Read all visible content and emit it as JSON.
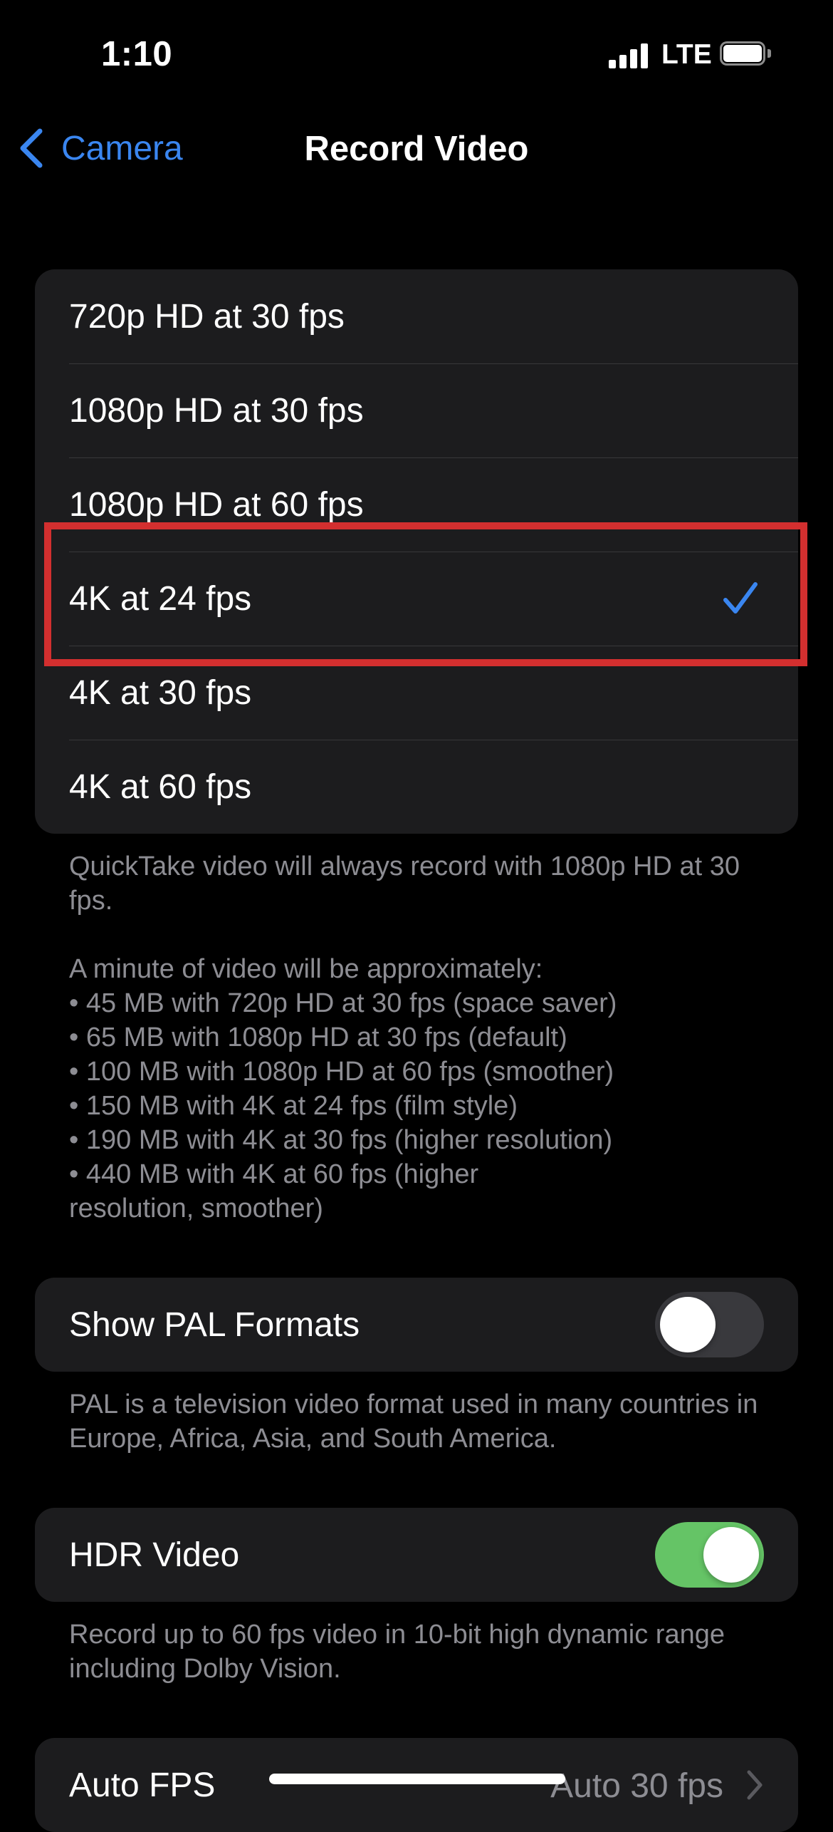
{
  "status_bar": {
    "time": "1:10",
    "network": "LTE",
    "signal_bars": 4,
    "battery_icon": "battery-full-icon"
  },
  "nav": {
    "back_label": "Camera",
    "title": "Record Video"
  },
  "formats": [
    {
      "label": "720p HD at 30 fps",
      "selected": false
    },
    {
      "label": "1080p HD at 30 fps",
      "selected": false
    },
    {
      "label": "1080p HD at 60 fps",
      "selected": false
    },
    {
      "label": "4K at 24 fps",
      "selected": true
    },
    {
      "label": "4K at 30 fps",
      "selected": false
    },
    {
      "label": "4K at 60 fps",
      "selected": false
    }
  ],
  "formats_footnote": {
    "quicktake": "QuickTake video will always record with 1080p HD at 30 fps.",
    "size_intro": "A minute of video will be approximately:",
    "sizes": [
      "• 45 MB with 720p HD at 30 fps (space saver)",
      "• 65 MB with 1080p HD at 30 fps (default)",
      "• 100 MB with 1080p HD at 60 fps (smoother)",
      "• 150 MB with 4K at 24 fps (film style)",
      "• 190 MB with 4K at 30 fps (higher resolution)",
      "• 440 MB with 4K at 60 fps (higher resolution, smoother)"
    ]
  },
  "pal": {
    "label": "Show PAL Formats",
    "enabled": false,
    "footnote": "PAL is a television video format used in many countries in Europe, Africa, Asia, and South America."
  },
  "hdr": {
    "label": "HDR Video",
    "enabled": true,
    "footnote": "Record up to 60 fps video in 10-bit high dynamic range including Dolby Vision."
  },
  "auto_fps": {
    "label": "Auto FPS",
    "value": "Auto 30 fps"
  },
  "colors": {
    "accent": "#3a86f0",
    "toggle_on": "#65c466",
    "highlight": "#d32f2f"
  }
}
